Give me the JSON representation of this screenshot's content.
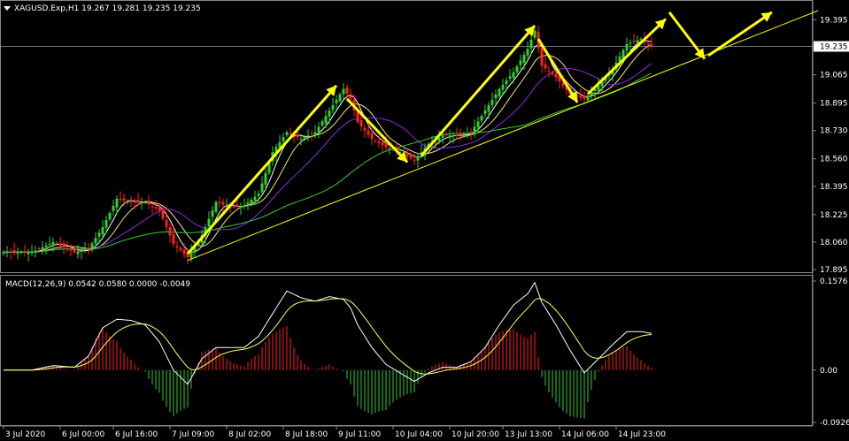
{
  "chart_data": [
    {
      "type": "candlestick",
      "header": "XAGUSD.Exp,H1  19.267 19.281 19.235 19.235",
      "ylim": [
        17.89,
        19.45
      ],
      "y_ticks": [
        "19.395",
        "19.235",
        "19.065",
        "18.895",
        "18.730",
        "18.560",
        "18.395",
        "18.225",
        "18.060",
        "17.895"
      ],
      "current_price": "19.235",
      "x_labels": [
        "3 Jul 2020",
        "6 Jul 00:00",
        "6 Jul 16:00",
        "7 Jul 09:00",
        "8 Jul 02:00",
        "8 Jul 18:00",
        "9 Jul 11:00",
        "10 Jul 04:00",
        "10 Jul 20:00",
        "13 Jul 13:00",
        "14 Jul 06:00",
        "14 Jul 23:00"
      ],
      "close_anchors": [
        [
          0,
          18.0
        ],
        [
          8,
          18.0
        ],
        [
          14,
          18.06
        ],
        [
          20,
          18.0
        ],
        [
          24,
          18.02
        ],
        [
          28,
          18.15
        ],
        [
          32,
          18.32
        ],
        [
          36,
          18.3
        ],
        [
          40,
          18.3
        ],
        [
          44,
          18.25
        ],
        [
          48,
          18.05
        ],
        [
          52,
          17.97
        ],
        [
          56,
          18.1
        ],
        [
          60,
          18.3
        ],
        [
          64,
          18.27
        ],
        [
          68,
          18.28
        ],
        [
          72,
          18.35
        ],
        [
          76,
          18.6
        ],
        [
          80,
          18.72
        ],
        [
          84,
          18.68
        ],
        [
          88,
          18.72
        ],
        [
          92,
          18.85
        ],
        [
          96,
          18.98
        ],
        [
          98,
          18.92
        ],
        [
          100,
          18.78
        ],
        [
          104,
          18.68
        ],
        [
          108,
          18.63
        ],
        [
          112,
          18.6
        ],
        [
          116,
          18.55
        ],
        [
          120,
          18.65
        ],
        [
          124,
          18.7
        ],
        [
          128,
          18.7
        ],
        [
          132,
          18.72
        ],
        [
          136,
          18.85
        ],
        [
          140,
          18.98
        ],
        [
          144,
          19.08
        ],
        [
          148,
          19.22
        ],
        [
          150,
          19.33
        ],
        [
          152,
          19.12
        ],
        [
          156,
          19.05
        ],
        [
          160,
          18.95
        ],
        [
          164,
          18.92
        ],
        [
          168,
          19.0
        ],
        [
          172,
          19.1
        ],
        [
          176,
          19.25
        ],
        [
          180,
          19.28
        ],
        [
          183,
          19.24
        ]
      ],
      "trendline": {
        "from": [
          52,
          17.95
        ],
        "to": [
          230,
          19.45
        ]
      },
      "forecast_arrows": [
        [
          [
            52,
            17.99
          ],
          [
            94,
            19.0
          ]
        ],
        [
          [
            97,
            18.92
          ],
          [
            114,
            18.54
          ]
        ],
        [
          [
            118,
            18.58
          ],
          [
            150,
            19.36
          ]
        ],
        [
          [
            151,
            19.28
          ],
          [
            162,
            18.9
          ]
        ],
        [
          [
            165,
            18.95
          ],
          [
            187,
            19.4
          ]
        ],
        [
          [
            188,
            19.44
          ],
          [
            198,
            19.16
          ]
        ],
        [
          [
            199,
            19.18
          ],
          [
            217,
            19.44
          ]
        ]
      ],
      "moving_averages": [
        {
          "color": "#ffffff",
          "period": 5
        },
        {
          "color": "#f0e68c",
          "period": 10
        },
        {
          "color": "#8a2be2",
          "period": 20
        },
        {
          "color": "#32cd32",
          "period": 50
        }
      ],
      "colors": {
        "up": "#32cd32",
        "down": "#ff2020",
        "trend": "#ffff00",
        "arrow": "#ffff00"
      }
    },
    {
      "type": "macd",
      "header": "MACD(12,26,9) 0.0542 0.0580 0.0000 -0.0049",
      "ylim": [
        -0.0926,
        0.1576
      ],
      "y_ticks": [
        "0.1576",
        "0.00",
        "-0.0926"
      ],
      "macd_anchors": [
        [
          0,
          0.0
        ],
        [
          8,
          0.0
        ],
        [
          14,
          0.008
        ],
        [
          20,
          0.005
        ],
        [
          24,
          0.025
        ],
        [
          28,
          0.075
        ],
        [
          32,
          0.09
        ],
        [
          36,
          0.088
        ],
        [
          40,
          0.08
        ],
        [
          44,
          0.05
        ],
        [
          48,
          0.0
        ],
        [
          52,
          -0.025
        ],
        [
          56,
          0.02
        ],
        [
          60,
          0.04
        ],
        [
          64,
          0.04
        ],
        [
          68,
          0.04
        ],
        [
          72,
          0.06
        ],
        [
          76,
          0.1
        ],
        [
          80,
          0.14
        ],
        [
          84,
          0.128
        ],
        [
          88,
          0.122
        ],
        [
          92,
          0.13
        ],
        [
          96,
          0.125
        ],
        [
          98,
          0.11
        ],
        [
          100,
          0.08
        ],
        [
          104,
          0.04
        ],
        [
          108,
          0.01
        ],
        [
          112,
          -0.005
        ],
        [
          116,
          -0.02
        ],
        [
          120,
          -0.005
        ],
        [
          124,
          0.005
        ],
        [
          128,
          0.005
        ],
        [
          132,
          0.015
        ],
        [
          136,
          0.04
        ],
        [
          140,
          0.08
        ],
        [
          144,
          0.115
        ],
        [
          148,
          0.135
        ],
        [
          150,
          0.155
        ],
        [
          152,
          0.12
        ],
        [
          156,
          0.08
        ],
        [
          160,
          0.035
        ],
        [
          164,
          -0.005
        ],
        [
          168,
          0.02
        ],
        [
          172,
          0.045
        ],
        [
          176,
          0.068
        ],
        [
          180,
          0.068
        ],
        [
          183,
          0.065
        ]
      ]
    }
  ]
}
